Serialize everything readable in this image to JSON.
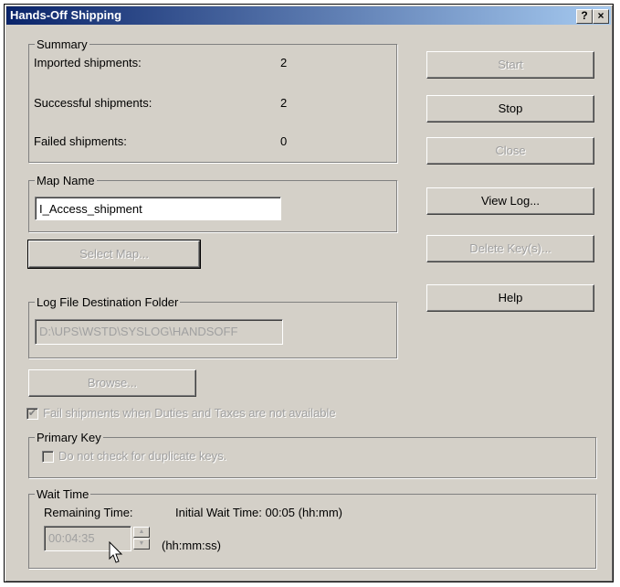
{
  "window": {
    "title": "Hands-Off Shipping",
    "help_btn": "?",
    "close_btn": "×"
  },
  "summary": {
    "legend": "Summary",
    "rows": [
      {
        "label": "Imported shipments:",
        "value": "2"
      },
      {
        "label": "Successful shipments:",
        "value": "2"
      },
      {
        "label": "Failed shipments:",
        "value": "0"
      }
    ]
  },
  "map": {
    "legend": "Map Name",
    "value": "I_Access_shipment",
    "select_btn": "Select Map..."
  },
  "log_folder": {
    "legend": "Log File Destination Folder",
    "value": "D:\\UPS\\WSTD\\SYSLOG\\HANDSOFF",
    "browse_btn": "Browse..."
  },
  "fail_duties": {
    "label": "Fail shipments when Duties and Taxes are not available",
    "checked": true
  },
  "primary_key": {
    "legend": "Primary Key",
    "checkbox_label": "Do not check for duplicate keys.",
    "checked": false
  },
  "wait_time": {
    "legend": "Wait Time",
    "remaining_label": "Remaining Time:",
    "initial_label": "Initial Wait Time: 00:05 (hh:mm)",
    "remaining_value": "00:04:35",
    "unit": "(hh:mm:ss)"
  },
  "buttons": {
    "start": "Start",
    "stop": "Stop",
    "close": "Close",
    "view_log": "View Log...",
    "delete_keys": "Delete Key(s)...",
    "help": "Help"
  },
  "icons": {
    "checkbox_check": "✔",
    "spin_up": "▲",
    "spin_down": "▼"
  }
}
